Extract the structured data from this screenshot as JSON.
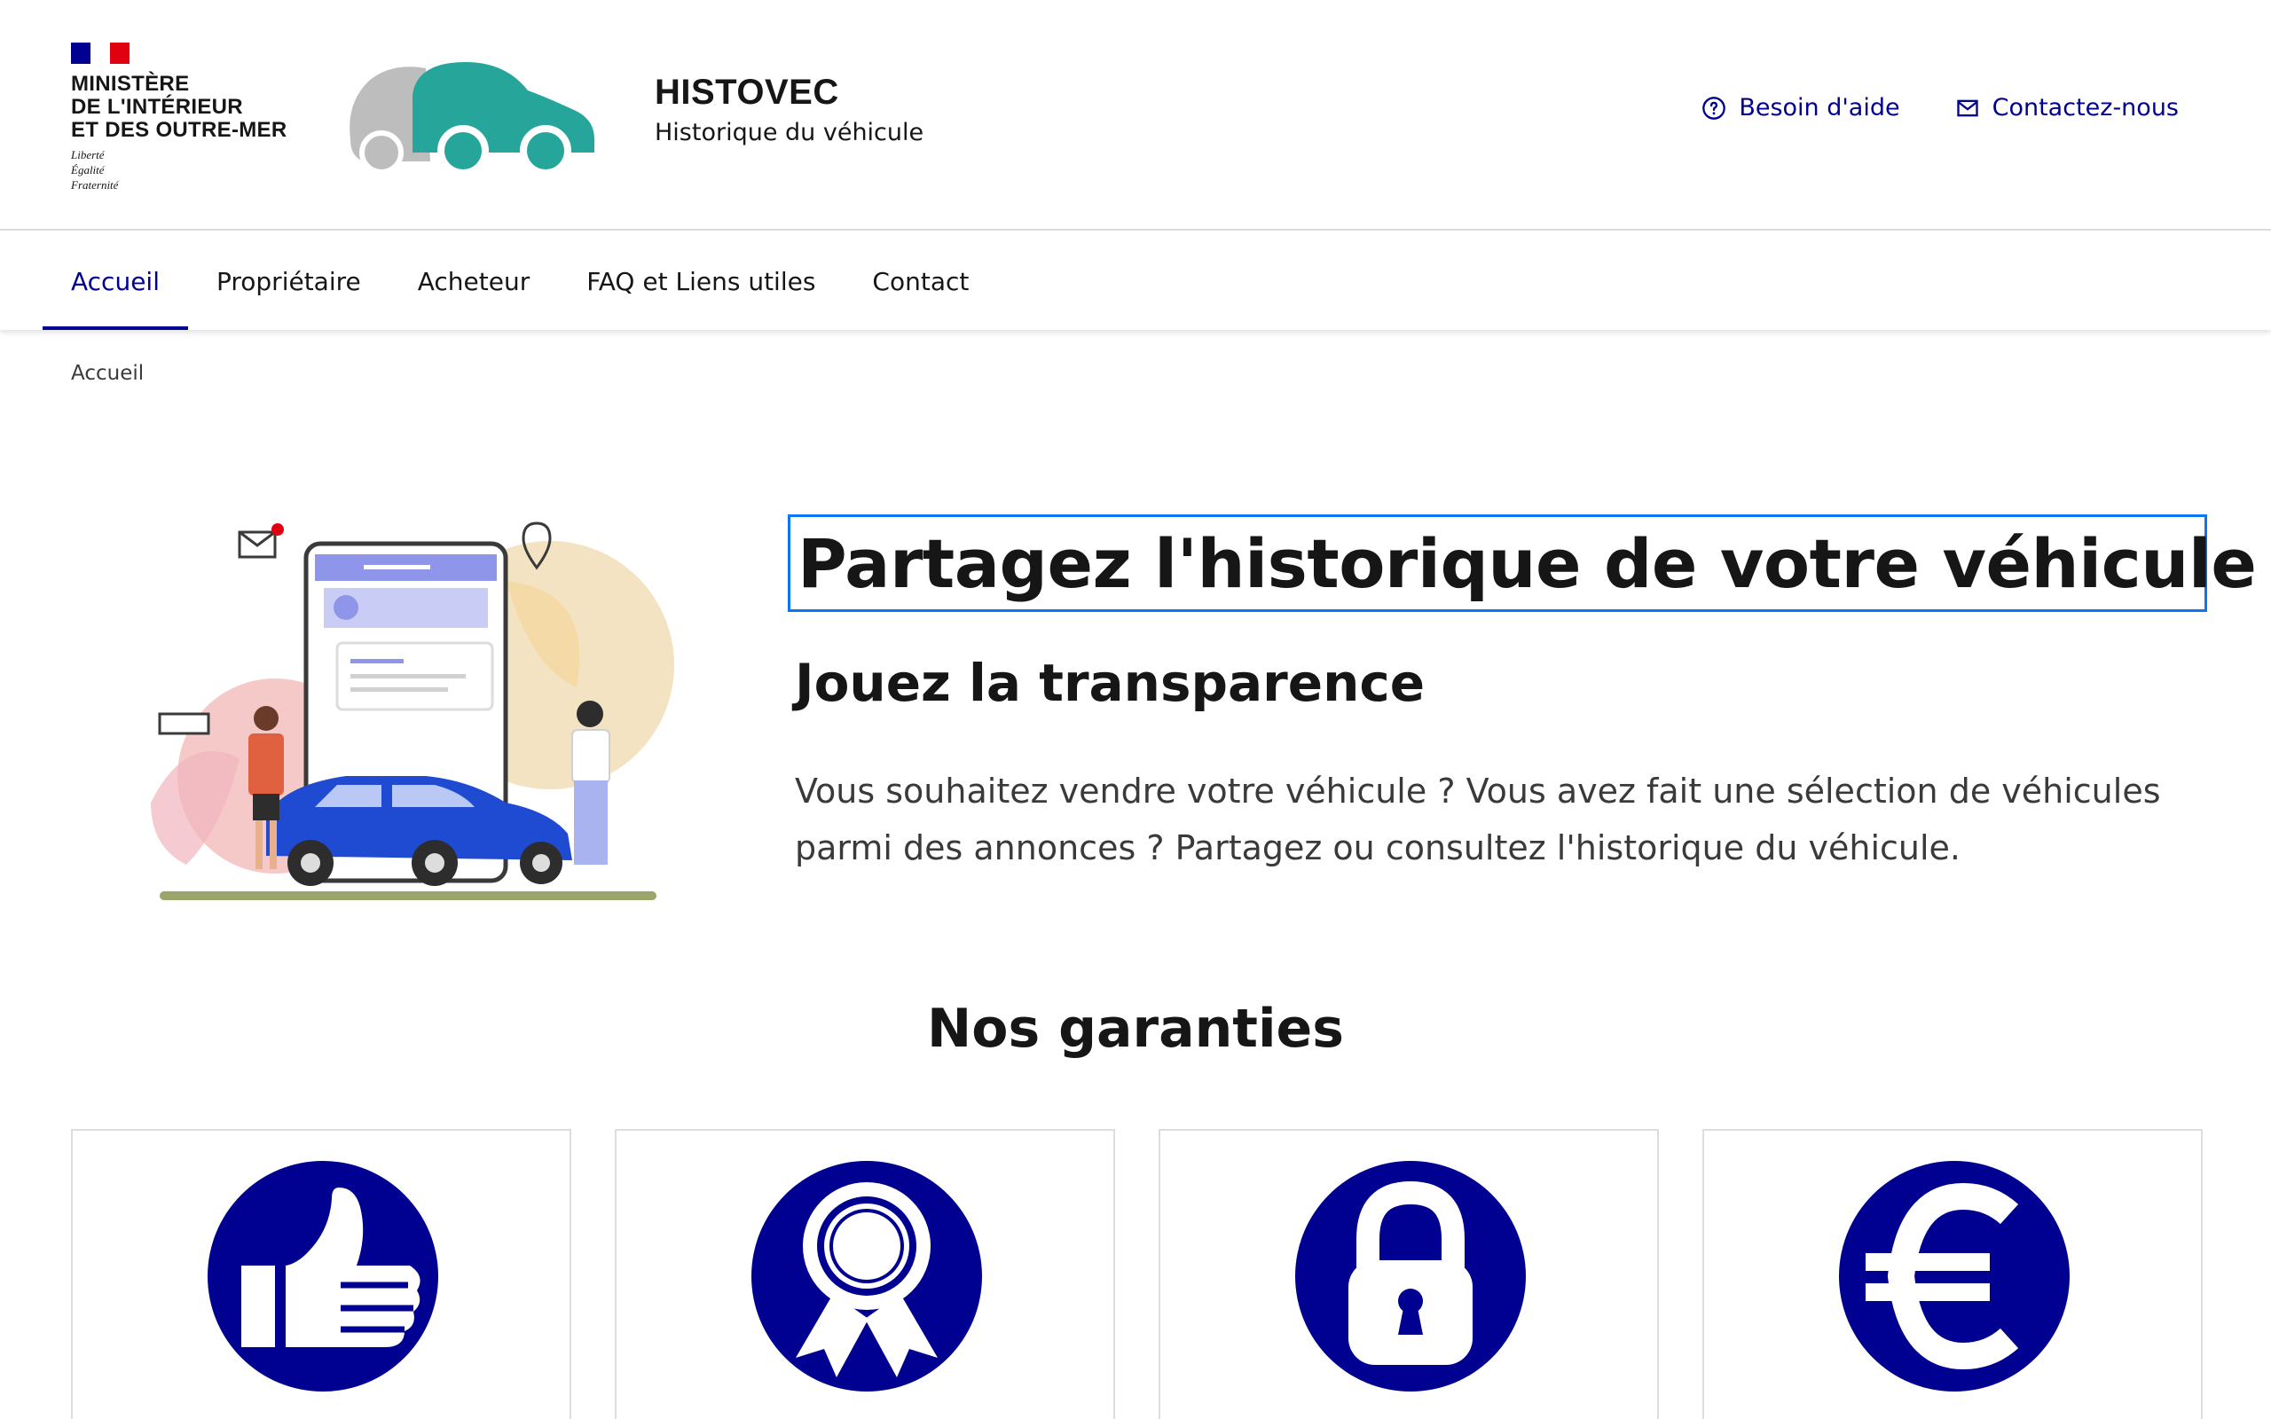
{
  "header": {
    "ministry_lines": [
      "MINISTÈRE",
      "DE L'INTÉRIEUR",
      "ET DES OUTRE-MER"
    ],
    "devise_lines": [
      "Liberté",
      "Égalité",
      "Fraternité"
    ],
    "service_title": "HISTOVEC",
    "service_tagline": "Historique du véhicule",
    "links": {
      "help": "Besoin d'aide",
      "contact": "Contactez-nous"
    }
  },
  "nav": {
    "items": [
      "Accueil",
      "Propriétaire",
      "Acheteur",
      "FAQ et Liens utiles",
      "Contact"
    ],
    "active": "Accueil"
  },
  "breadcrumb": {
    "current": "Accueil"
  },
  "hero": {
    "title": "Partagez l'historique de votre véhicule",
    "subtitle": "Jouez la transparence",
    "text": "Vous souhaitez vendre votre véhicule ? Vous avez fait une sélection de véhicules parmi des annonces ? Partagez ou consultez l'historique du véhicule."
  },
  "garanties": {
    "title": "Nos garanties",
    "cards": [
      {
        "icon": "thumbs-up-icon"
      },
      {
        "icon": "award-ribbon-icon"
      },
      {
        "icon": "padlock-icon"
      },
      {
        "icon": "euro-icon"
      }
    ]
  },
  "colors": {
    "primary": "#000091",
    "logo_teal": "#26a69a",
    "logo_grey": "#bdbdbd",
    "flag_blue": "#000091",
    "flag_red": "#e1000f",
    "focus_outline": "#0a76f6"
  }
}
